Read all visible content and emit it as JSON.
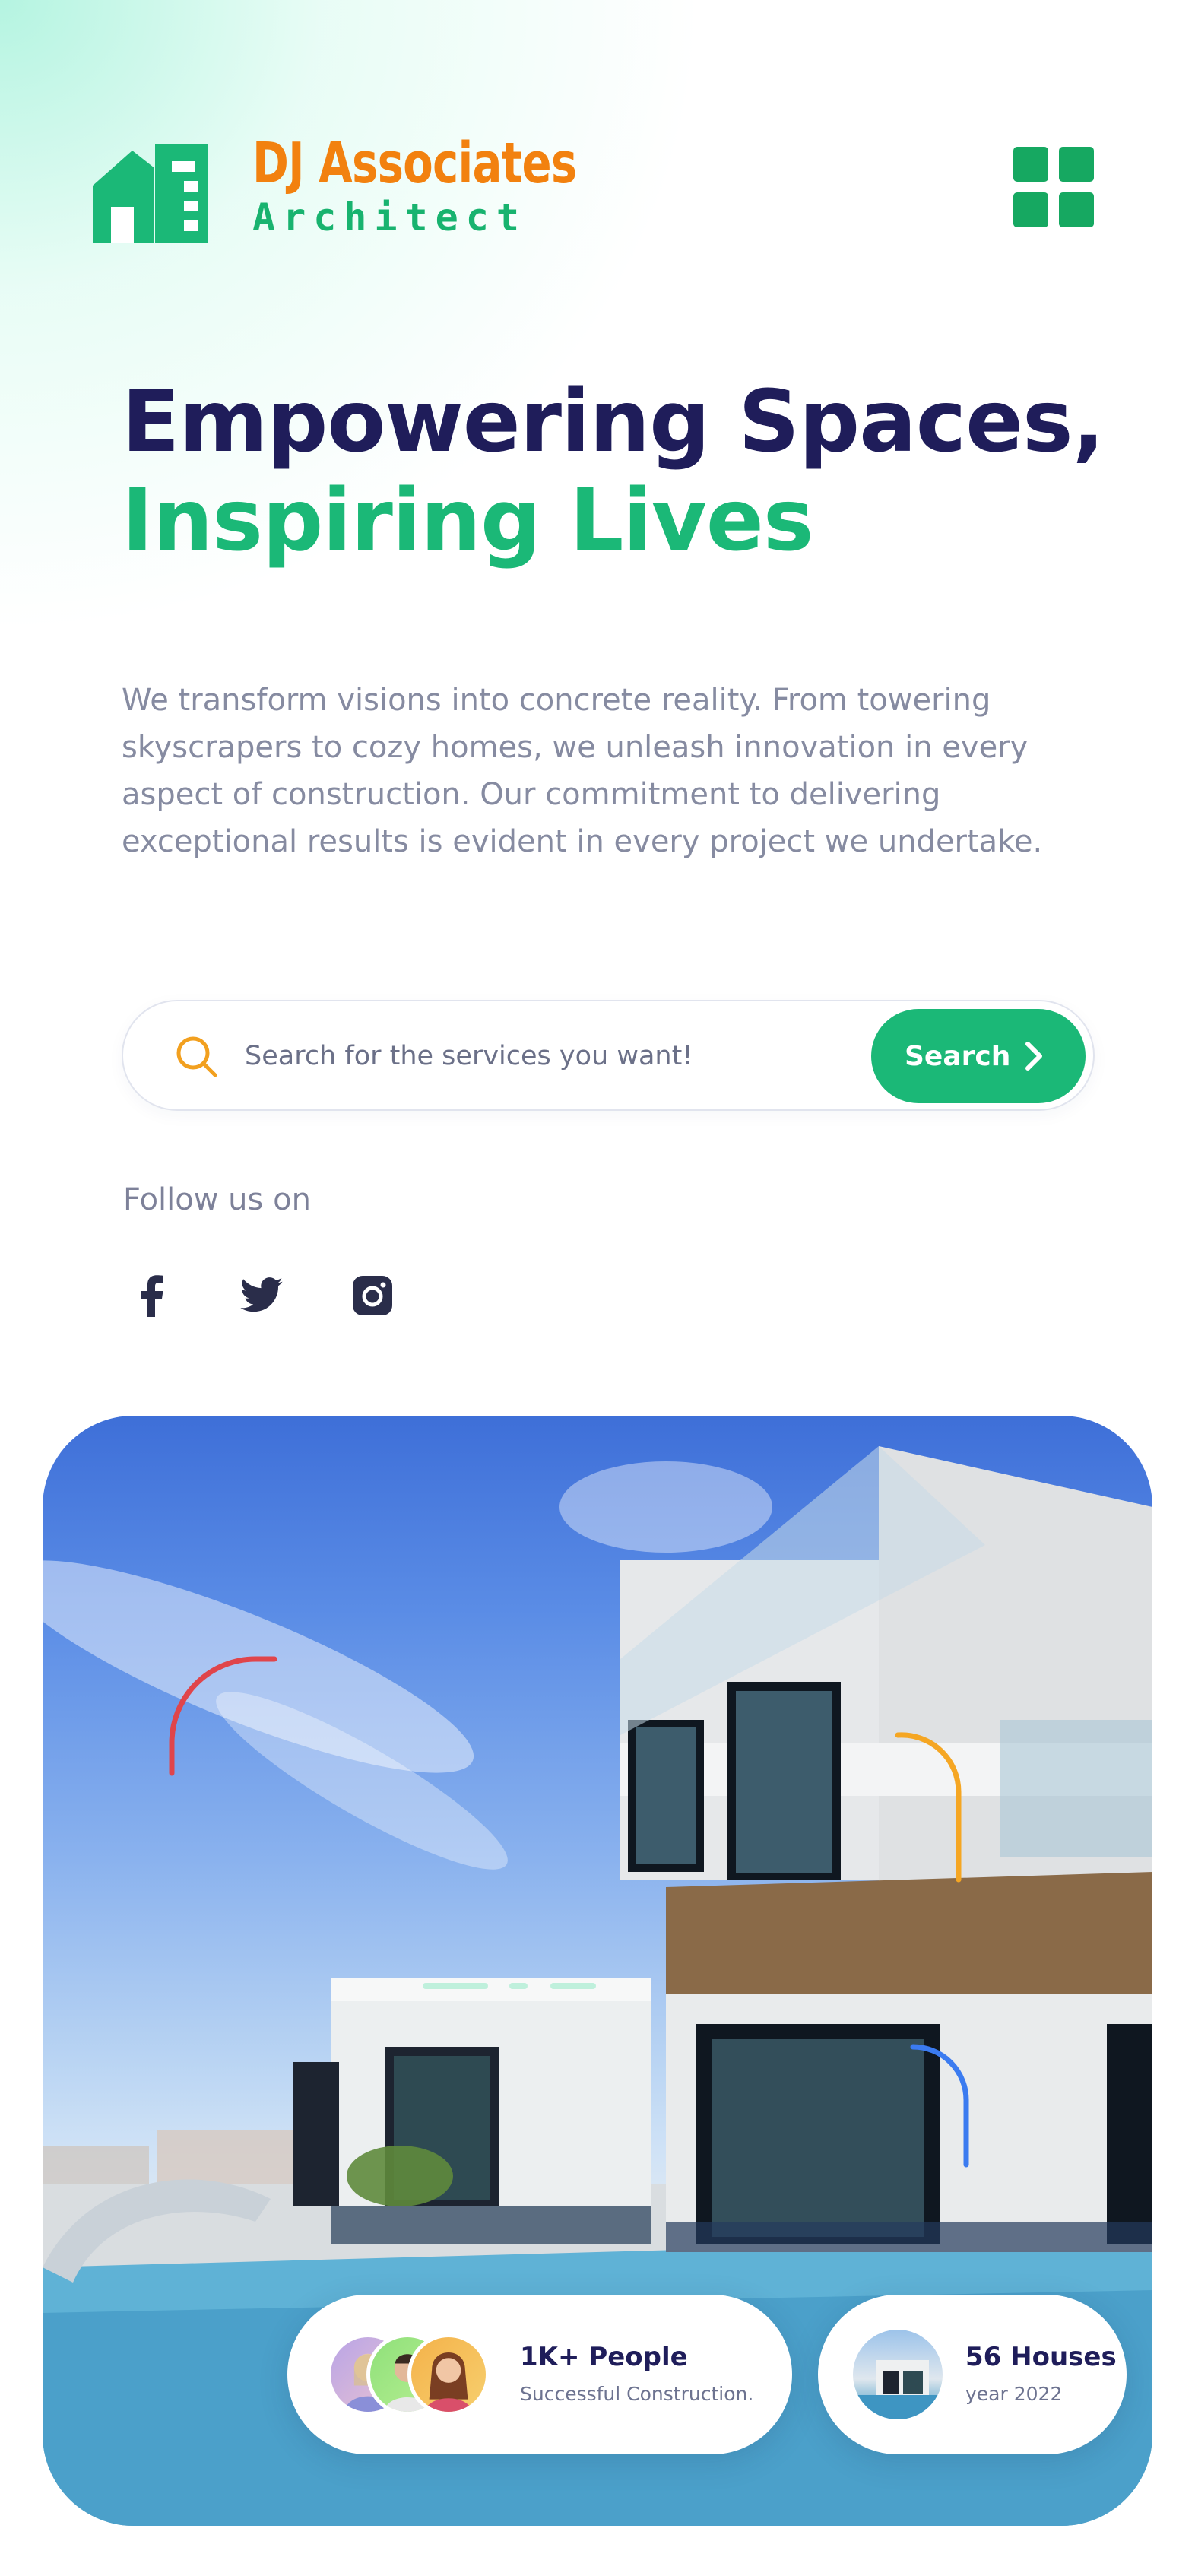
{
  "brand": {
    "name": "DJ Associates",
    "tagline": "Architect",
    "color_primary": "#f2810f",
    "color_secondary": "#18b36f"
  },
  "header": {
    "menu_icon": "grid-menu-icon"
  },
  "hero": {
    "headline_line1": "Empowering Spaces,",
    "headline_line2": "Inspiring Lives",
    "description": "We transform visions into concrete reality. From towering skyscrapers to cozy homes, we unleash innovation in every aspect of construction. Our commitment to delivering exceptional results is evident in every project we undertake."
  },
  "search": {
    "placeholder": "Search for the services you want!",
    "value": "",
    "button_label": "Search",
    "icon": "search-icon"
  },
  "social": {
    "label": "Follow us on",
    "items": [
      {
        "name": "facebook",
        "icon": "facebook-icon"
      },
      {
        "name": "twitter",
        "icon": "twitter-icon"
      },
      {
        "name": "instagram",
        "icon": "instagram-icon"
      }
    ]
  },
  "stats": {
    "people": {
      "title": "1K+ People",
      "subtitle": "Successful Construction."
    },
    "houses": {
      "title": "56 Houses",
      "subtitle": "year 2022"
    }
  },
  "colors": {
    "navy": "#1f1d5a",
    "green": "#1bb877",
    "accent_red": "#e0454b",
    "accent_orange": "#f5a623",
    "accent_blue": "#3b7bf0"
  }
}
